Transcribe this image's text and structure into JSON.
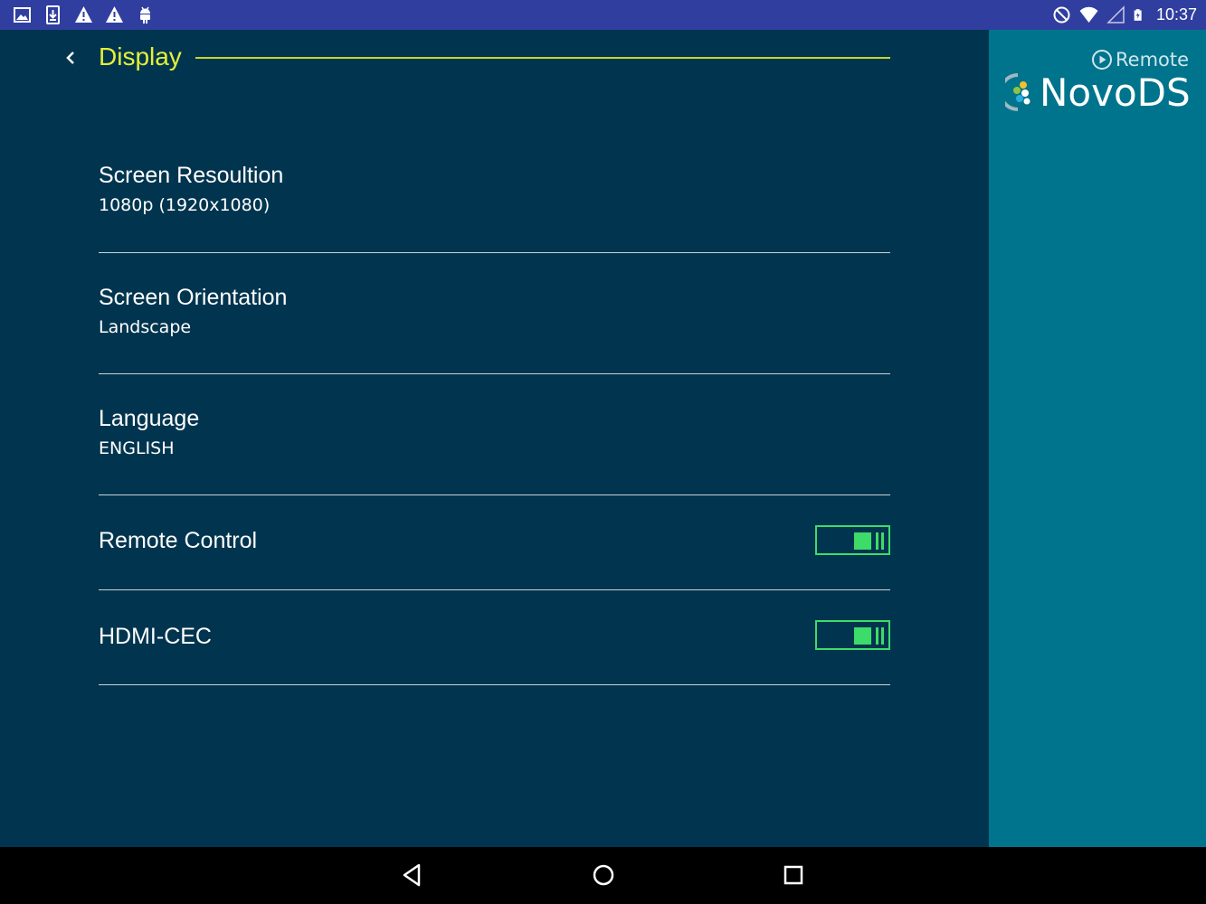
{
  "status_bar": {
    "left_icons": [
      "image-icon",
      "download-icon",
      "warning-icon",
      "warning-icon",
      "android-icon"
    ],
    "right_icons": [
      "do-not-disturb-icon",
      "wifi-icon",
      "signal-icon",
      "battery-charging-icon"
    ],
    "time": "10:37"
  },
  "header": {
    "title": "Display",
    "accent_color": "#e5f039"
  },
  "settings": [
    {
      "title": "Screen Resoultion",
      "value": "1080p (1920x1080)"
    },
    {
      "title": "Screen Orientation",
      "value": "Landscape"
    },
    {
      "title": "Language",
      "value": "ENGLISH"
    },
    {
      "title": "Remote Control",
      "toggle": true
    },
    {
      "title": "HDMI-CEC",
      "toggle": true
    }
  ],
  "brand": {
    "remote_label": "Remote",
    "name_part1": "Novo",
    "name_part2": "DS"
  },
  "nav": [
    "back-icon",
    "home-icon",
    "recents-icon"
  ],
  "colors": {
    "status_bar": "#303f9f",
    "main_bg": "#01354f",
    "side_bg": "#00748d",
    "toggle_on": "#3ddc68"
  }
}
